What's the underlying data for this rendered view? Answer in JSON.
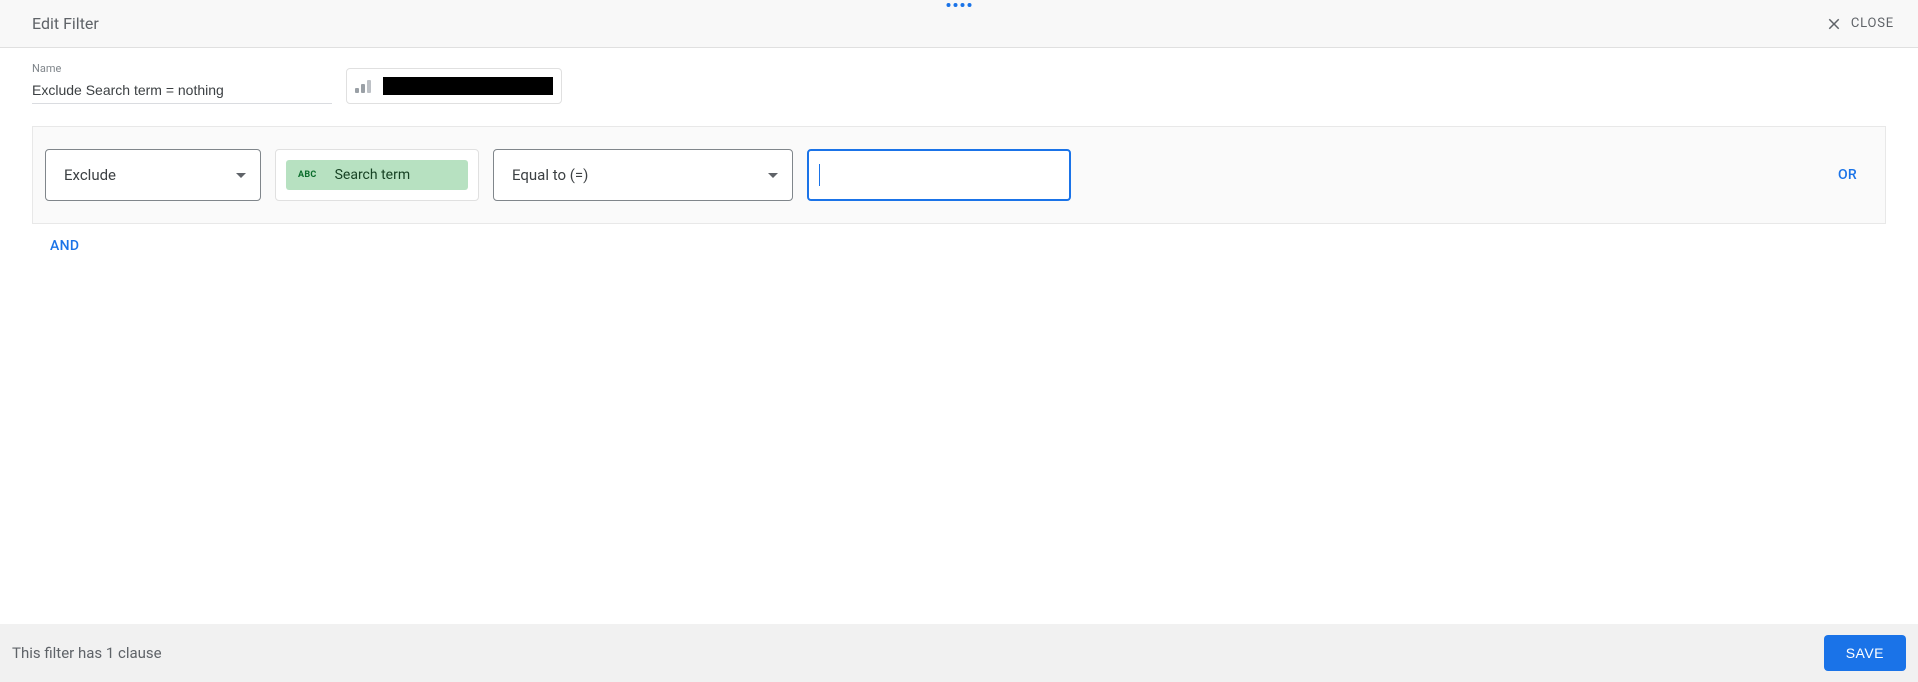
{
  "header": {
    "title": "Edit Filter",
    "close_label": "CLOSE"
  },
  "name_field": {
    "label": "Name",
    "value": "Exclude Search term = nothing"
  },
  "field_chip": {
    "icon": "bar-chart-icon",
    "text_redacted": true
  },
  "clause": {
    "include_exclude": "Exclude",
    "dimension": {
      "type_tag": "ABC",
      "label": "Search term"
    },
    "condition": "Equal to (=)",
    "value": ""
  },
  "operators": {
    "or": "OR",
    "and": "AND"
  },
  "footer": {
    "status": "This filter has 1 clause",
    "save": "SAVE"
  },
  "colors": {
    "accent": "#1a73e8",
    "dimension_pill": "#b7e1c1"
  }
}
